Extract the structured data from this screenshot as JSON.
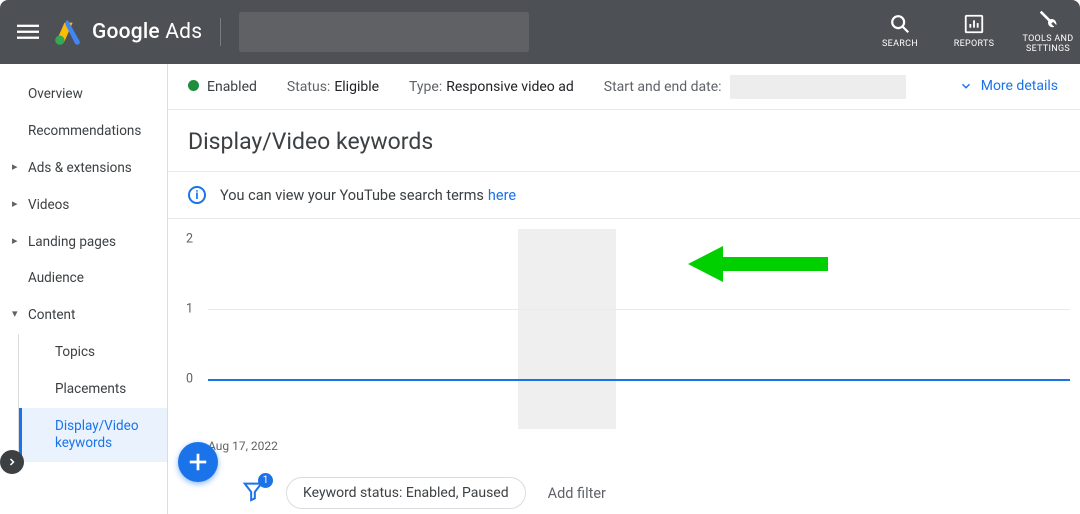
{
  "top": {
    "brand_html_a": "Google",
    "brand_html_b": "Ads",
    "actions": {
      "search": "SEARCH",
      "reports": "REPORTS",
      "tools": "TOOLS AND SETTINGS"
    }
  },
  "sidebar": [
    {
      "label": "Overview"
    },
    {
      "label": "Recommendations"
    },
    {
      "label": "Ads & extensions"
    },
    {
      "label": "Videos"
    },
    {
      "label": "Landing pages"
    },
    {
      "label": "Audience"
    },
    {
      "label": "Content"
    },
    {
      "label": "Topics"
    },
    {
      "label": "Placements"
    },
    {
      "label": "Display/Video keywords"
    }
  ],
  "status": {
    "enabled": "Enabled",
    "status_k": "Status:",
    "status_v": "Eligible",
    "type_k": "Type:",
    "type_v": "Responsive video ad",
    "date_k": "Start and end date:",
    "more": "More details"
  },
  "page_title": "Display/Video keywords",
  "info": {
    "text": "You can view your YouTube search terms",
    "link": "here"
  },
  "chart_data": {
    "type": "line",
    "ylim": [
      0,
      2
    ],
    "yticks": [
      0,
      1,
      2
    ],
    "x_start_label": "Aug 17, 2022",
    "values_all_zero": true
  },
  "filter": {
    "badge": "1",
    "chip": "Keyword status: Enabled, Paused",
    "add": "Add filter"
  }
}
